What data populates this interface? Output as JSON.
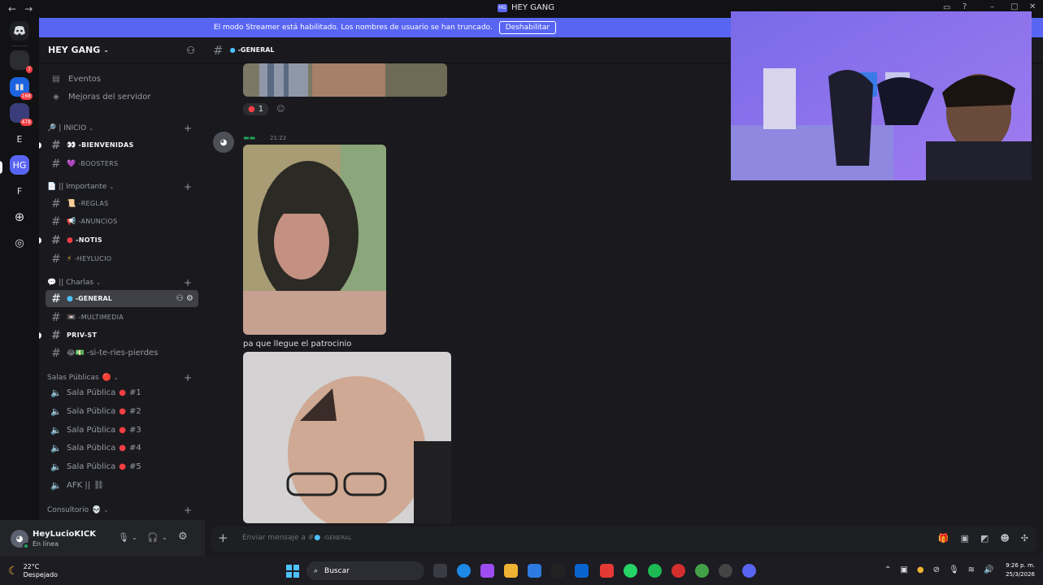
{
  "window": {
    "title": "HEY GANG",
    "logo_text": "HG",
    "back_icon": "←",
    "forward_icon": "→"
  },
  "banner": {
    "text": "El modo Streamer está habilitado. Los nombres de usuario se han truncado.",
    "button": "Deshabilitar"
  },
  "rail": {
    "servers": [
      {
        "label": "",
        "badge": "7"
      },
      {
        "label": "",
        "badge": "168"
      },
      {
        "label": "",
        "badge": "478"
      },
      {
        "label": "E",
        "badge": ""
      },
      {
        "label": "HG",
        "badge": ""
      },
      {
        "label": "F",
        "badge": ""
      }
    ]
  },
  "sidebar": {
    "server_name": "HEY GANG",
    "top_items": [
      {
        "label": "Eventos"
      },
      {
        "label": "Mejoras del servidor"
      }
    ],
    "categories": {
      "inicio": "| INICIO",
      "importante": "|| Importante",
      "charlas": "|| Charlas",
      "salas": "Salas Públicas",
      "consultorio": "Consultorio"
    },
    "channels": {
      "bienvenidas": "-BIENVENIDAS",
      "boosters": "-BOOSTERS",
      "reglas": "-REGLAS",
      "anuncios": "-ANUNCIOS",
      "notis": "-NOTIS",
      "heylucio": "-HEYLUCIO",
      "general": "-GENERAL",
      "multimedia": "-MULTIMEDIA",
      "priv": "PRIV-ST",
      "risas": "-si-te-ries-pierdes"
    },
    "voice": [
      {
        "label": "Sala Pública",
        "num": "#1"
      },
      {
        "label": "Sala Pública",
        "num": "#2"
      },
      {
        "label": "Sala Pública",
        "num": "#3"
      },
      {
        "label": "Sala Pública",
        "num": "#4"
      },
      {
        "label": "Sala Pública",
        "num": "#5"
      },
      {
        "label": "AFK ||",
        "num": ""
      }
    ]
  },
  "user": {
    "name": "HeyLucioKICK",
    "status": "En línea"
  },
  "chat": {
    "channel": "-GENERAL",
    "reaction_count": "1",
    "time": "21:22",
    "message": "pa que llegue el patrocinio",
    "composer_placeholder": "Enviar mensaje a #",
    "composer_channel": "-GENERAL"
  },
  "taskbar": {
    "temp": "22°C",
    "weather": "Despejado",
    "search": "Buscar",
    "time": "9:26 p. m.",
    "date": "25/3/2026"
  }
}
